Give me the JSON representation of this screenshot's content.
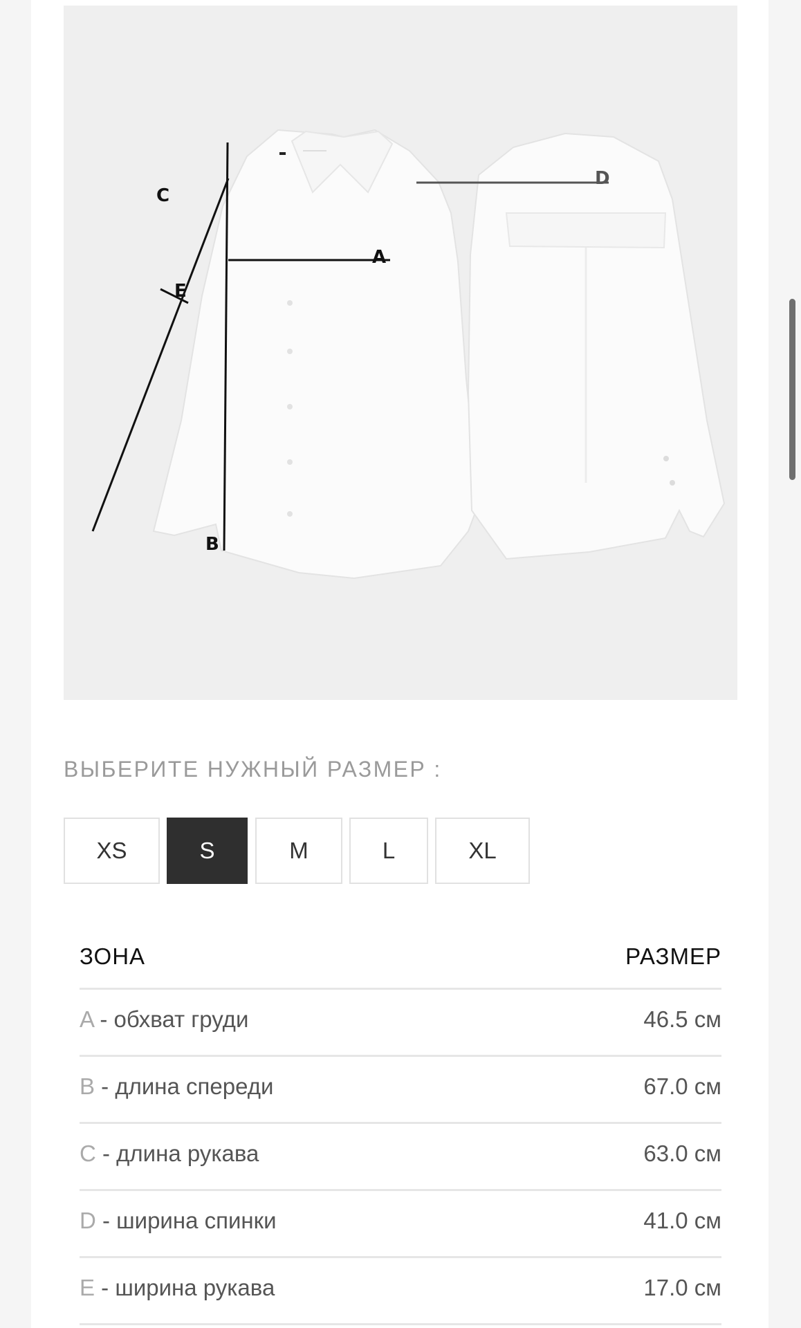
{
  "figure": {
    "labels": [
      "A",
      "B",
      "C",
      "D",
      "E"
    ]
  },
  "size_selector": {
    "title": "ВЫБЕРИТЕ НУЖНЫЙ РАЗМЕР :",
    "sizes": [
      "XS",
      "S",
      "M",
      "L",
      "XL"
    ],
    "selected": "S"
  },
  "table": {
    "header_zone": "ЗОНА",
    "header_size": "РАЗМЕР",
    "rows": [
      {
        "letter": "A",
        "label": " - обхват груди",
        "value": "46.5 см"
      },
      {
        "letter": "B",
        "label": " - длина спереди",
        "value": "67.0 см"
      },
      {
        "letter": "C",
        "label": " - длина рукава",
        "value": "63.0 см"
      },
      {
        "letter": "D",
        "label": " - ширина спинки",
        "value": "41.0 см"
      },
      {
        "letter": "E",
        "label": " - ширина рукава",
        "value": "17.0 см"
      }
    ]
  },
  "colors": {
    "selected_bg": "#2f2f2f",
    "panel_bg": "#efefef"
  }
}
